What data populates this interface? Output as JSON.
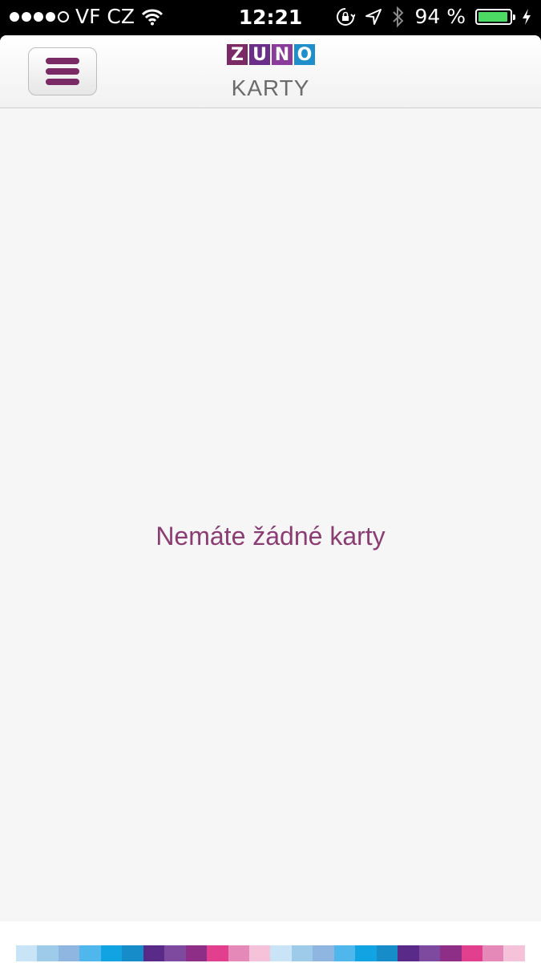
{
  "status_bar": {
    "signal_filled": 4,
    "signal_total": 5,
    "carrier": "VF CZ",
    "time": "12:21",
    "battery_percent_label": "94 %",
    "battery_level": 0.94,
    "battery_color": "#4cd964",
    "icons": [
      "wifi-icon",
      "rotation-lock-icon",
      "location-icon",
      "bluetooth-icon",
      "charging-icon"
    ]
  },
  "header": {
    "menu_icon": "hamburger-icon",
    "logo_letters": [
      "Z",
      "U",
      "N",
      "O"
    ],
    "logo_colors": [
      "#7a2a65",
      "#6b2f8a",
      "#8b3c9a",
      "#1e8fc8"
    ],
    "title": "KARTY"
  },
  "main": {
    "empty_message": "Nemáte žádné karty"
  },
  "footer": {
    "stripe_colors": [
      "#c8e4f6",
      "#9fcbeb",
      "#8fb6e0",
      "#4fb7ec",
      "#12a3e2",
      "#168cc8",
      "#5a2a88",
      "#7e4aa0",
      "#8f2e86",
      "#e23f8f",
      "#e58ab8",
      "#f6c2da",
      "#c8e4f6",
      "#9fcbeb",
      "#8fb6e0",
      "#4fb7ec",
      "#12a3e2",
      "#168cc8",
      "#5a2a88",
      "#7e4aa0",
      "#8f2e86",
      "#e23f8f",
      "#e58ab8",
      "#f6c2da"
    ]
  }
}
